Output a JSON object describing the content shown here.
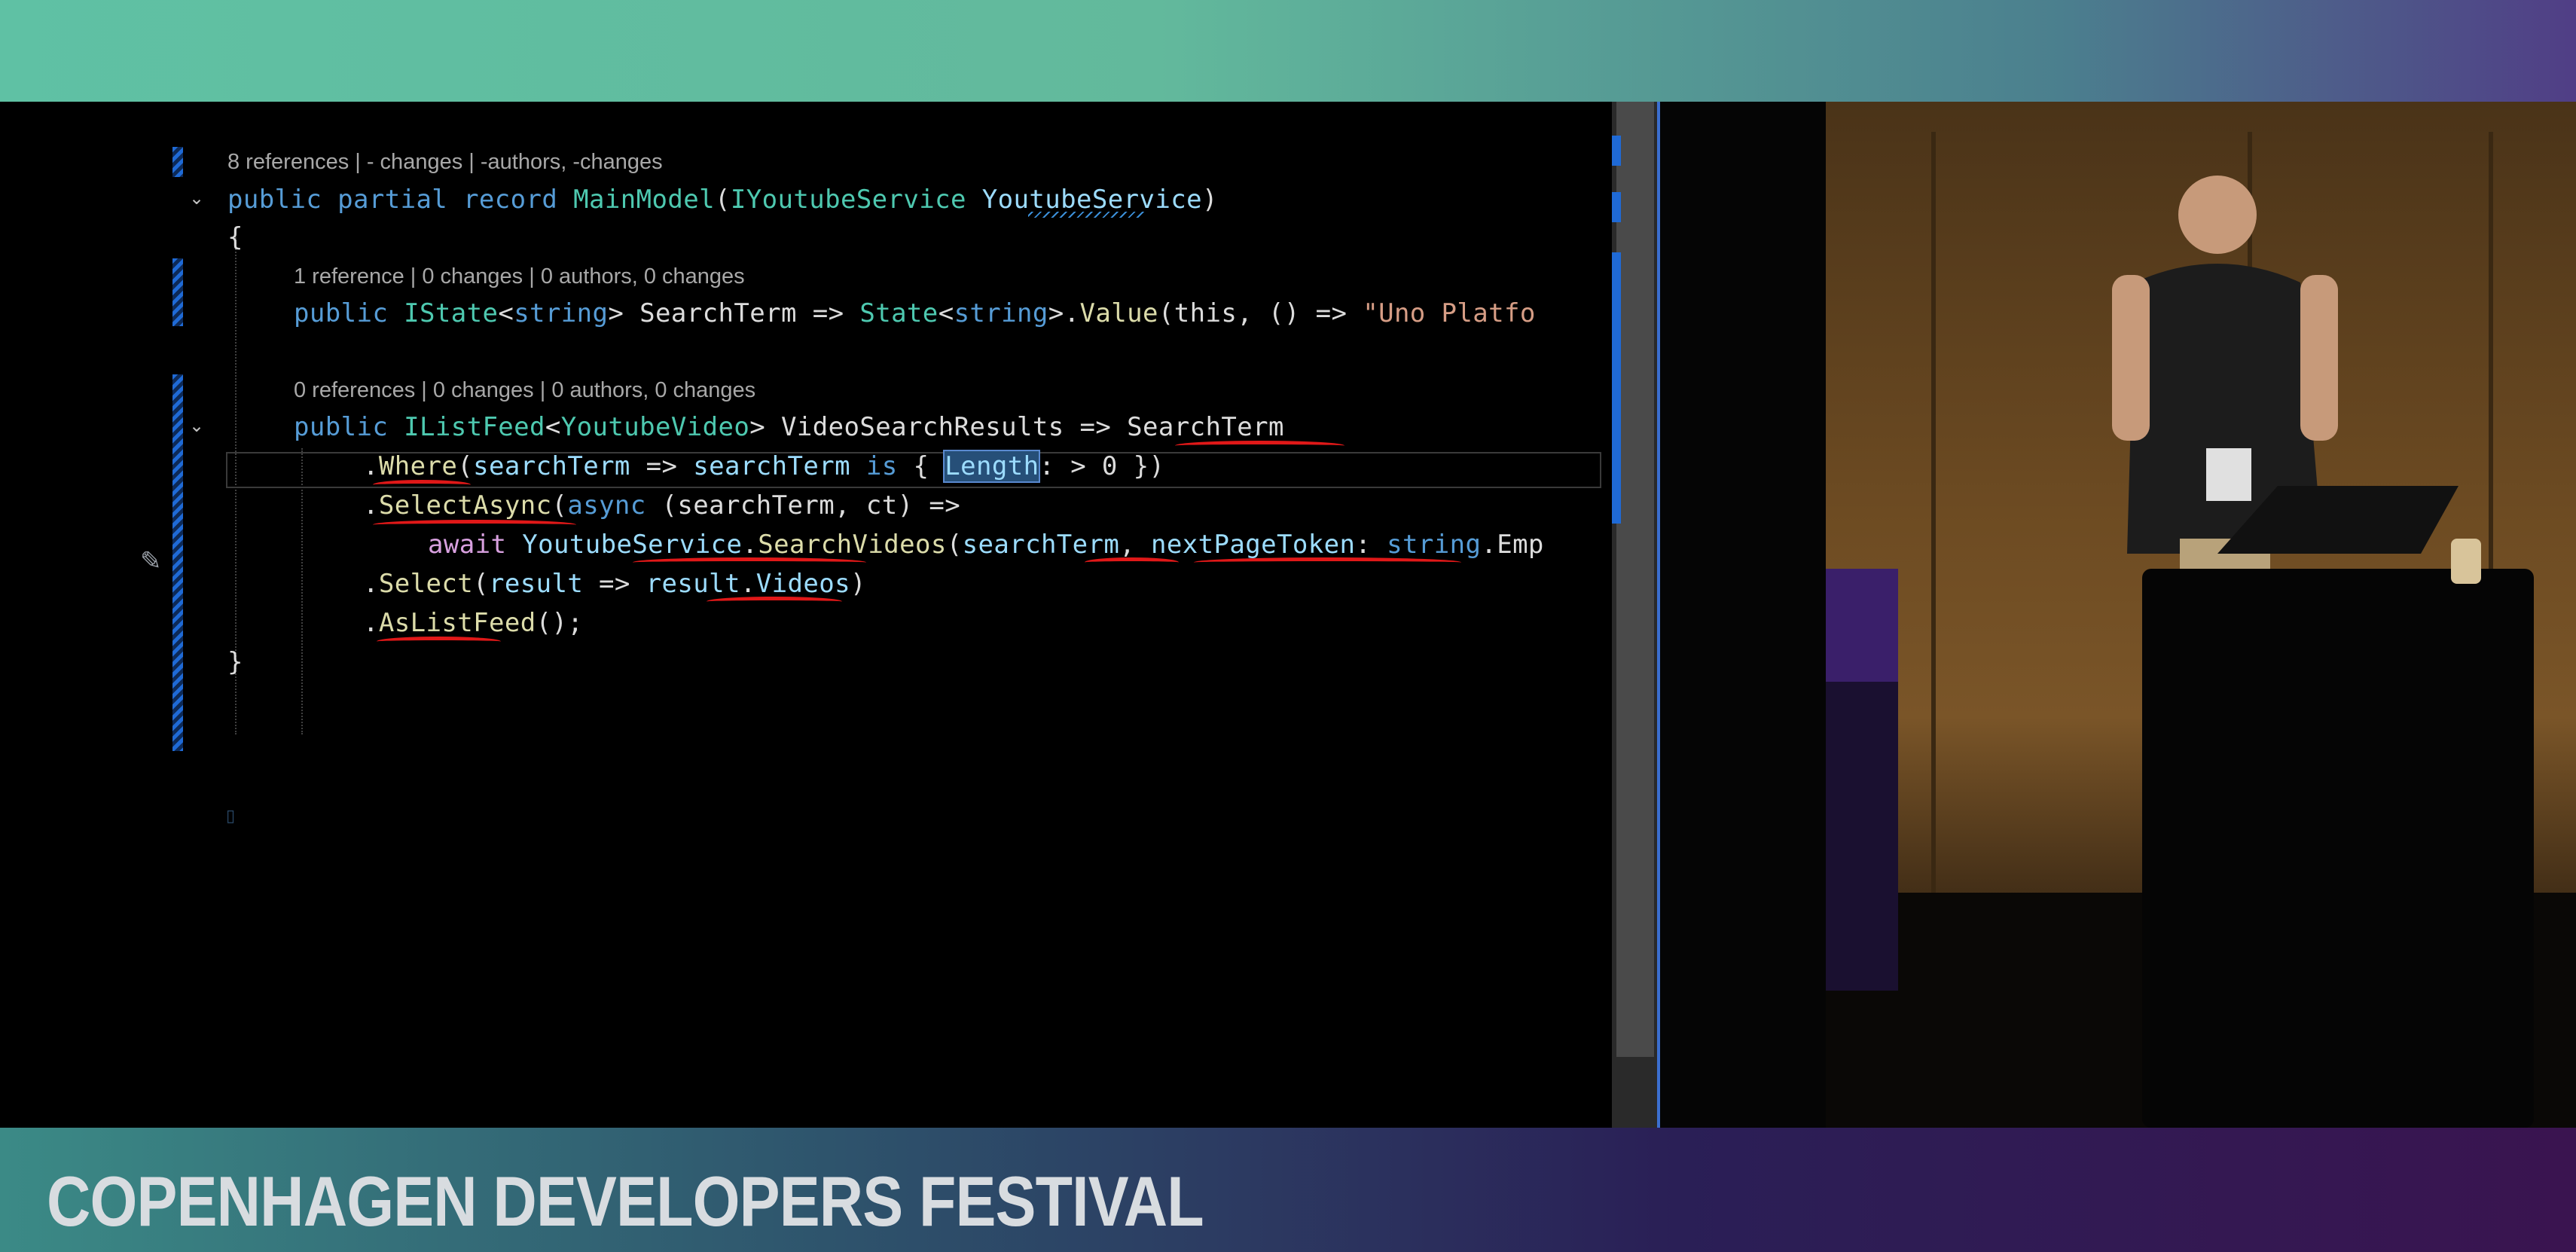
{
  "banner": {
    "title": "COPENHAGEN DEVELOPERS FESTIVAL"
  },
  "editor": {
    "codelens": [
      "8 references | - changes | -authors, -changes",
      "1 reference | 0 changes | 0 authors, 0 changes",
      "0 references | 0 changes | 0 authors, 0 changes"
    ],
    "lines": {
      "l1": {
        "kw1": "public",
        "kw2": "partial",
        "kw3": "record",
        "name": "MainModel",
        "p1": "(",
        "ptype": "IYoutubeService",
        "sp": " ",
        "pname": "YoutubeService",
        "p2": ")"
      },
      "l2": {
        "text": "{"
      },
      "l3": {
        "kw": "public",
        "type": "IState",
        "lt": "<",
        "gen": "string",
        "gt": ">",
        "name": " SearchTerm => ",
        "state": "State",
        "lt2": "<",
        "gen2": "string",
        "gt2": ">",
        "dot": ".",
        "fn": "Value",
        "args": "(this, () => ",
        "str": "\"Uno Platfo"
      },
      "l4": {
        "kw": "public",
        "type": "IListFeed",
        "lt": "<",
        "gen": "YoutubeVideo",
        "gt": ">",
        "name": " VideoSearchResults => ",
        "ref": "SearchTerm"
      },
      "l5": {
        "dot": ".",
        "fn": "Where",
        "p1": "(",
        "a": "searchTerm",
        "arrow": " => ",
        "b": "searchTerm",
        "is": " is ",
        "brace": "{ ",
        "len": "Length",
        "rest": ": > 0 })"
      },
      "l6": {
        "dot": ".",
        "fn": "SelectAsync",
        "p1": "(",
        "kw": "async",
        "rest": " (searchTerm, ct) =>"
      },
      "l7": {
        "kw": "await",
        "svc": " YoutubeService",
        "dot": ".",
        "fn": "SearchVideos",
        "p1": "(",
        "arg": "searchTerm",
        "comma": ", ",
        "named": "nextPageToken",
        "colon": ": ",
        "kw2": "string",
        "rest": ".Emp"
      },
      "l8": {
        "dot": ".",
        "fn": "Select",
        "p1": "(",
        "a": "result",
        "arrow": " => ",
        "b": "result",
        "dot2": ".",
        "c": "Videos",
        "p2": ")"
      },
      "l9": {
        "dot": ".",
        "fn": "AsListFeed",
        "rest": "();"
      },
      "l10": {
        "text": "}"
      }
    }
  }
}
